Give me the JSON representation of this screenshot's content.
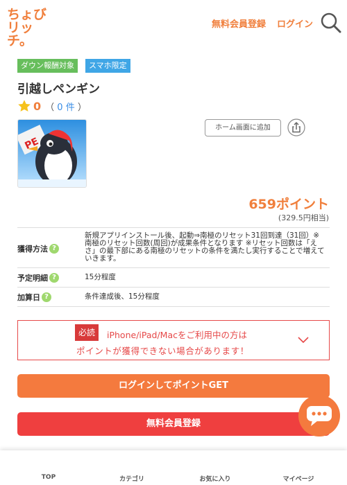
{
  "header": {
    "logo_line1": "ちょび",
    "logo_line2": "リッチ。",
    "register_label": "無料会員登録",
    "login_label": "ログイン",
    "search_icon": "search-icon",
    "brand_color": "#f07f3c"
  },
  "badges": {
    "download": "ダウン報酬対象",
    "smartphone": "スマホ限定"
  },
  "app": {
    "title": "引越しペンギン",
    "rating_score": "0",
    "rating_count_open": "（",
    "rating_count_value": "0",
    "rating_count_unit": "件",
    "rating_count_close": "）",
    "home_screen_button": "ホーム画面に追加",
    "share_icon": "share-icon"
  },
  "points": {
    "value": "659ポイント",
    "yen": "(329.5円相当)"
  },
  "info": {
    "method_label": "獲得方法",
    "method_value": "新規アプリインストール後、起動⇒南極のリセット31回到達（31回）※南極のリセット回数(周回)が成果条件となります ※リセット回数は「えさ」の最下部にある南極のリセットの条件を満たし実行することで増えていきます。",
    "schedule_label": "予定明細",
    "schedule_value": "15分程度",
    "add_label": "加算日",
    "add_value": "条件達成後、15分程度",
    "help_glyph": "?"
  },
  "notice": {
    "required_tag": "必読",
    "line1": "iPhone/iPad/Macをご利用中の方は",
    "line2": "ポイントが獲得できない場合があります！"
  },
  "buttons": {
    "login_get": "ログインしてポイントGET",
    "register": "無料会員登録"
  },
  "bottom_nav": {
    "top": "TOP",
    "category": "カテゴリ",
    "favorites": "お気に入り",
    "mypage": "マイページ"
  }
}
